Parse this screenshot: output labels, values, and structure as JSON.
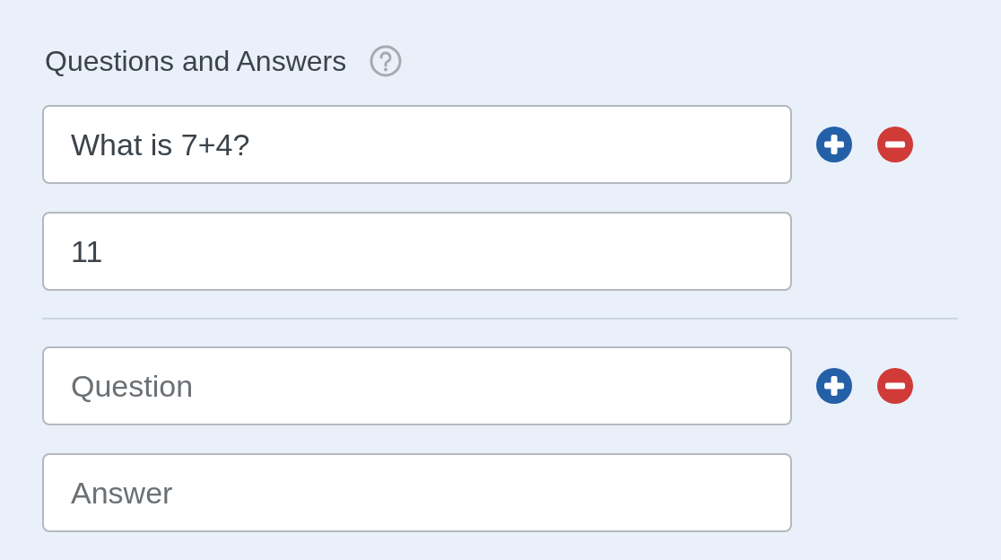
{
  "title": "Questions and Answers",
  "pairs": [
    {
      "question": {
        "value": "What is 7+4?"
      },
      "answer": {
        "value": "11"
      }
    },
    {
      "question": {
        "placeholder": "Question"
      },
      "answer": {
        "placeholder": "Answer"
      }
    }
  ]
}
